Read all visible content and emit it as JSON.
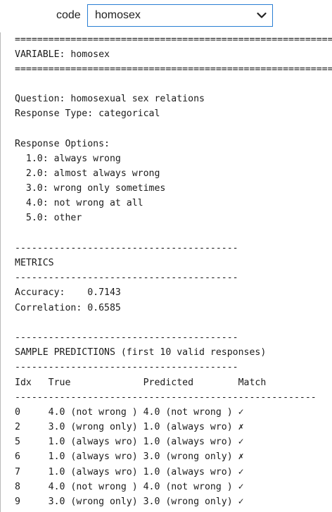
{
  "selector": {
    "label": "code",
    "selected": "homosex"
  },
  "output_lines": [
    "========================================================================",
    "VARIABLE: homosex",
    "========================================================================",
    "",
    "Question: homosexual sex relations",
    "Response Type: categorical",
    "",
    "Response Options:",
    "  1.0: always wrong",
    "  2.0: almost always wrong",
    "  3.0: wrong only sometimes",
    "  4.0: not wrong at all",
    "  5.0: other",
    "",
    "----------------------------------------",
    "METRICS",
    "----------------------------------------",
    "Accuracy:    0.7143",
    "Correlation: 0.6585",
    "",
    "----------------------------------------",
    "SAMPLE PREDICTIONS (first 10 valid responses)",
    "----------------------------------------",
    "Idx   True             Predicted        Match",
    "------------------------------------------------------",
    "0     4.0 (not wrong ) 4.0 (not wrong ) ✓",
    "2     3.0 (wrong only) 1.0 (always wro) ✗",
    "5     1.0 (always wro) 1.0 (always wro) ✓",
    "6     1.0 (always wro) 3.0 (wrong only) ✗",
    "7     1.0 (always wro) 1.0 (always wro) ✓",
    "8     4.0 (not wrong ) 4.0 (not wrong ) ✓",
    "9     3.0 (wrong only) 3.0 (wrong only) ✓"
  ]
}
